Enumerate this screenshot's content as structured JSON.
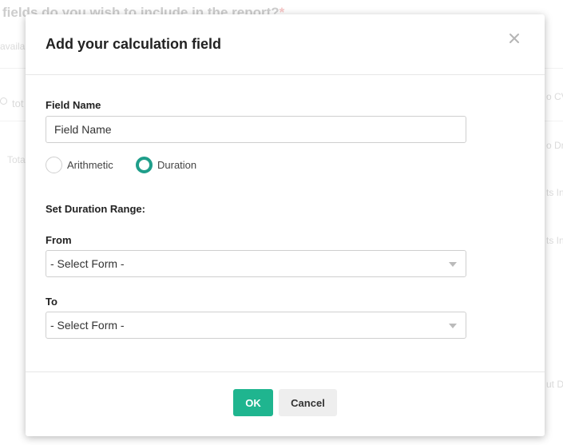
{
  "background": {
    "question": "fields do you wish to include in the report?",
    "required_mark": "*",
    "subtext": "availa",
    "search_text": "tot",
    "total_text": "Tota",
    "right_items": [
      "o CV",
      "o Dro",
      "ts In",
      "ts In",
      "ut D"
    ]
  },
  "modal": {
    "title": "Add your calculation field",
    "close_icon": "×",
    "field_name_label": "Field Name",
    "field_name_value": "Field Name",
    "radio_options": [
      {
        "label": "Arithmetic",
        "checked": false
      },
      {
        "label": "Duration",
        "checked": true
      }
    ],
    "range_label": "Set Duration Range:",
    "from_label": "From",
    "from_value": "- Select Form -",
    "to_label": "To",
    "to_value": "- Select Form -",
    "ok_label": "OK",
    "cancel_label": "Cancel"
  },
  "colors": {
    "accent": "#1fb58f",
    "radio_checked": "#1f9e8a"
  }
}
